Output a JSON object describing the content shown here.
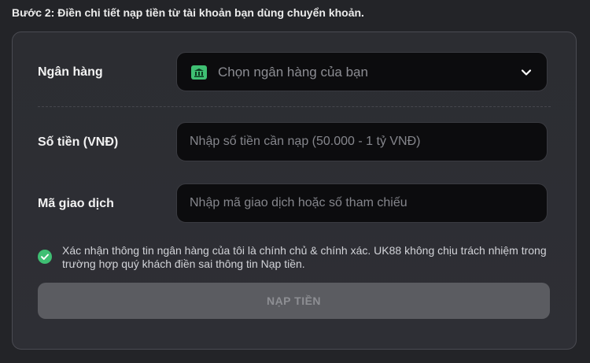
{
  "step_title": "Bước 2: Điền chi tiết nạp tiền từ tài khoản bạn dùng chuyển khoản.",
  "form": {
    "bank": {
      "label": "Ngân hàng",
      "placeholder": "Chọn ngân hàng của bạn",
      "icon": "bank-icon"
    },
    "amount": {
      "label": "Số tiền (VNĐ)",
      "value": "",
      "placeholder": "Nhập số tiền cần nạp (50.000 - 1 tỷ VNĐ)"
    },
    "transaction_code": {
      "label": "Mã giao dịch",
      "value": "",
      "placeholder": "Nhập mã giao dịch hoặc số tham chiếu"
    },
    "confirm": {
      "checked": true,
      "text": "Xác nhận thông tin ngân hàng của tôi là chính chủ & chính xác. UK88 không chịu trách nhiệm trong trường hợp quý khách điền sai thông tin Nạp tiền."
    },
    "submit_label": "NẠP TIỀN"
  },
  "colors": {
    "accent_green": "#3fbf73",
    "background": "#232428",
    "field_background": "#0c0c0e",
    "button_disabled": "#5b5c61"
  }
}
